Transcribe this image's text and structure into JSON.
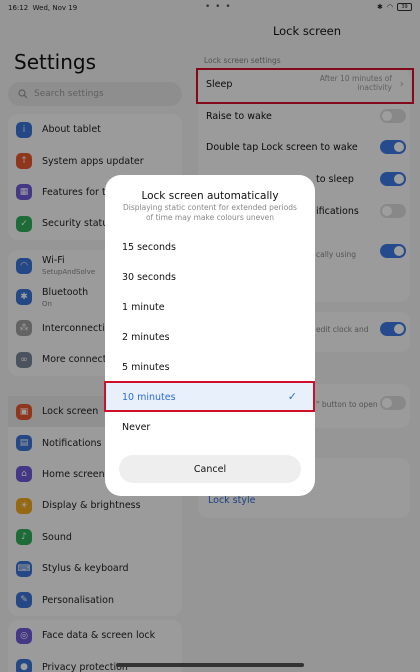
{
  "status": {
    "time": "16:12",
    "date": "Wed, Nov 19",
    "dots": "• • •",
    "battery": "39"
  },
  "left": {
    "title": "Settings",
    "search_placeholder": "Search settings",
    "items": [
      {
        "label": "About tablet",
        "icon": "info-icon",
        "color": "#3b73d9"
      },
      {
        "label": "System apps updater",
        "icon": "update-icon",
        "color": "#e8572e"
      },
      {
        "label": "Features for tablet",
        "icon": "features-icon",
        "color": "#6f5ad8"
      },
      {
        "label": "Security status",
        "icon": "shield-icon",
        "color": "#2fae5b"
      },
      {
        "label": "Wi-Fi",
        "sub": "SetupAndSolve",
        "icon": "wifi-icon",
        "color": "#3b73d9"
      },
      {
        "label": "Bluetooth",
        "sub": "On",
        "icon": "bluetooth-icon",
        "color": "#3b73d9"
      },
      {
        "label": "Interconnectivity",
        "icon": "interconnect-icon",
        "color": "#a0a0a0"
      },
      {
        "label": "More connectivity options",
        "icon": "link-icon",
        "color": "#7a8799"
      },
      {
        "label": "Lock screen",
        "icon": "lock-icon",
        "color": "#e8572e"
      },
      {
        "label": "Notifications & status bar",
        "icon": "notification-icon",
        "color": "#3b73d9"
      },
      {
        "label": "Home screen",
        "icon": "home-icon",
        "color": "#6f5ad8"
      },
      {
        "label": "Display & brightness",
        "icon": "sun-icon",
        "color": "#f0a81e"
      },
      {
        "label": "Sound",
        "icon": "sound-icon",
        "color": "#2fae5b"
      },
      {
        "label": "Stylus & keyboard",
        "icon": "keyboard-icon",
        "color": "#3b73d9"
      },
      {
        "label": "Personalisation",
        "icon": "personalisation-icon",
        "color": "#3b73d9"
      },
      {
        "label": "Face data & screen lock",
        "icon": "face-icon",
        "color": "#6f5ad8"
      },
      {
        "label": "Privacy protection",
        "icon": "privacy-icon",
        "color": "#3b73d9"
      }
    ]
  },
  "right": {
    "title": "Lock screen",
    "section": "Lock screen settings",
    "sleep": {
      "label": "Sleep",
      "value": "After 10 minutes of inactivity"
    },
    "raise": {
      "label": "Raise to wake"
    },
    "doubletap": {
      "label": "Double tap Lock screen to wake"
    },
    "row4_tail": "to sleep",
    "row5_tail": "ifications",
    "row6_tail": "cally using",
    "row7_tail": "edit clock and",
    "row8_tail": "\" button to open",
    "lockstyle": "Lock style"
  },
  "dialog": {
    "title": "Lock screen automatically",
    "subtitle": "Displaying static content for extended periods of time may make colours uneven",
    "options": [
      "15 seconds",
      "30 seconds",
      "1 minute",
      "2 minutes",
      "5 minutes",
      "10 minutes",
      "Never"
    ],
    "selected_index": 5,
    "cancel": "Cancel"
  },
  "colors": {
    "accent": "#2f6bd6",
    "highlight": "#d0102a"
  }
}
